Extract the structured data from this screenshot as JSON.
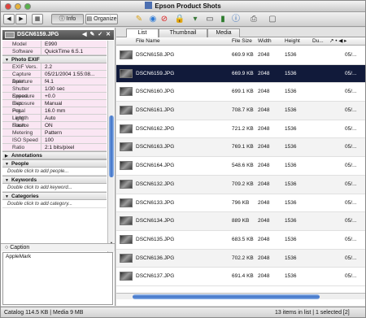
{
  "window": {
    "title": "Epson Product Shots"
  },
  "toolbar": {
    "info_label": "Info",
    "organize_label": "Organize"
  },
  "sidebar": {
    "header_filename": "DSCN6159.JPG",
    "header_icons": "◀ ✎ ✓ ✕",
    "rows_basic": [
      {
        "k": "Model",
        "v": "E990"
      },
      {
        "k": "Software",
        "v": "QuickTime 6.5.1"
      }
    ],
    "sections": {
      "photo_exif": "Photo EXIF",
      "annotations": "Annotations",
      "people": "People",
      "keywords": "Keywords",
      "categories": "Categories"
    },
    "exif_rows": [
      {
        "k": "EXIF Vers.",
        "v": "2.2"
      },
      {
        "k": "Capture Date",
        "v": "05/21/2004 1:55:08..."
      },
      {
        "k": "Aperture",
        "v": "f4.1"
      },
      {
        "k": "Shutter Speed",
        "v": "1/30 sec"
      },
      {
        "k": "Exposure Bias",
        "v": "+0.0"
      },
      {
        "k": "Exposure Prg.",
        "v": "Manual"
      },
      {
        "k": "Focal Length",
        "v": "16.0 mm"
      },
      {
        "k": "Light Source",
        "v": "Auto"
      },
      {
        "k": "Flash",
        "v": "ON"
      },
      {
        "k": "Metering",
        "v": "Pattern"
      },
      {
        "k": "ISO Speed",
        "v": "100"
      },
      {
        "k": "Ratio",
        "v": "2:1 bits/pixel"
      }
    ],
    "hints": {
      "people": "Double click to add people...",
      "keywords": "Double click to add keyword...",
      "categories": "Double click to add category..."
    },
    "caption_label": "Caption",
    "caption_value": "AppleMark"
  },
  "main": {
    "tabs": [
      "List",
      "Thumbnail",
      "Media"
    ],
    "columns": [
      "File Name",
      "File Size",
      "Width",
      "Height",
      "Du..."
    ],
    "header_icons": "↗ • ◀ ▸",
    "rows": [
      {
        "name": "DSCN6158.JPG",
        "size": "669.9 KB",
        "w": "2048",
        "h": "1536",
        "d": "05/..."
      },
      {
        "name": "DSCN6159.JPG",
        "size": "669.9 KB",
        "w": "2048",
        "h": "1536",
        "d": "05/..."
      },
      {
        "name": "DSCN6160.JPG",
        "size": "699.1 KB",
        "w": "2048",
        "h": "1536",
        "d": "05/..."
      },
      {
        "name": "DSCN6161.JPG",
        "size": "708.7 KB",
        "w": "2048",
        "h": "1536",
        "d": "05/..."
      },
      {
        "name": "DSCN6162.JPG",
        "size": "721.2 KB",
        "w": "2048",
        "h": "1536",
        "d": "05/..."
      },
      {
        "name": "DSCN6163.JPG",
        "size": "769.1 KB",
        "w": "2048",
        "h": "1536",
        "d": "05/..."
      },
      {
        "name": "DSCN6164.JPG",
        "size": "548.6 KB",
        "w": "2048",
        "h": "1536",
        "d": "05/..."
      },
      {
        "name": "DSCN6132.JPG",
        "size": "709.2 KB",
        "w": "2048",
        "h": "1536",
        "d": "05/..."
      },
      {
        "name": "DSCN6133.JPG",
        "size": "796 KB",
        "w": "2048",
        "h": "1536",
        "d": "05/..."
      },
      {
        "name": "DSCN6134.JPG",
        "size": "889 KB",
        "w": "2048",
        "h": "1536",
        "d": "05/..."
      },
      {
        "name": "DSCN6135.JPG",
        "size": "683.5 KB",
        "w": "2048",
        "h": "1536",
        "d": "05/..."
      },
      {
        "name": "DSCN6136.JPG",
        "size": "702.2 KB",
        "w": "2048",
        "h": "1536",
        "d": "05/..."
      },
      {
        "name": "DSCN6137.JPG",
        "size": "691.4 KB",
        "w": "2048",
        "h": "1536",
        "d": "05/..."
      }
    ]
  },
  "status": {
    "left": "Catalog  114.5 KB  |  Media 9 MB",
    "right": "13 items in list  |  1 selected [2]"
  }
}
